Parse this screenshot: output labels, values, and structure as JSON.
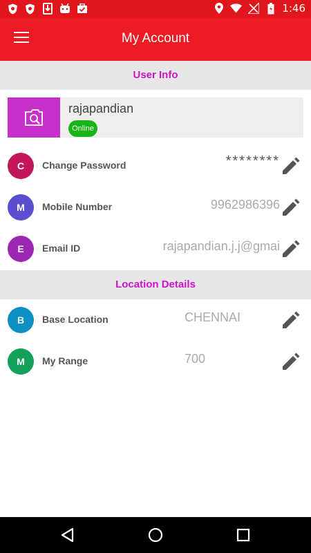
{
  "status_bar": {
    "time": "1:46",
    "left_icons": [
      "shield-notification-icon",
      "shield-notification-icon",
      "download-icon",
      "android-icon",
      "briefcase-check-icon"
    ],
    "right_icons": [
      "location-icon",
      "wifi-icon",
      "no-signal-icon",
      "battery-charging-icon"
    ]
  },
  "app_bar": {
    "title": "My Account",
    "menu_icon": "hamburger-menu-icon"
  },
  "user_info": {
    "header": "User Info",
    "username": "rajapandian",
    "status": "Online",
    "avatar_icon": "image-search-icon"
  },
  "user_fields": [
    {
      "initial": "C",
      "label": "Change Password",
      "value": "********",
      "color": "#c2185b",
      "edit_icon": "pencil-icon"
    },
    {
      "initial": "M",
      "label": "Mobile Number",
      "value": "9962986396",
      "color": "#5a4fcf",
      "edit_icon": "pencil-icon"
    },
    {
      "initial": "E",
      "label": "Email ID",
      "value": "rajapandian.j.j@gmai",
      "color": "#9c27b0",
      "edit_icon": "pencil-icon"
    }
  ],
  "location": {
    "header": "Location Details"
  },
  "location_fields": [
    {
      "initial": "B",
      "label": "Base Location",
      "value": "CHENNAI",
      "color": "#0d8fc4",
      "edit_icon": "pencil-icon"
    },
    {
      "initial": "M",
      "label": "My Range",
      "value": "700",
      "color": "#12a05a",
      "edit_icon": "pencil-icon"
    }
  ],
  "nav_bar": {
    "icons": [
      "back-triangle-icon",
      "home-circle-icon",
      "recents-square-icon"
    ]
  },
  "colors": {
    "primary": "#ed1c24",
    "accent": "#cc14cc",
    "online": "#17b517"
  }
}
